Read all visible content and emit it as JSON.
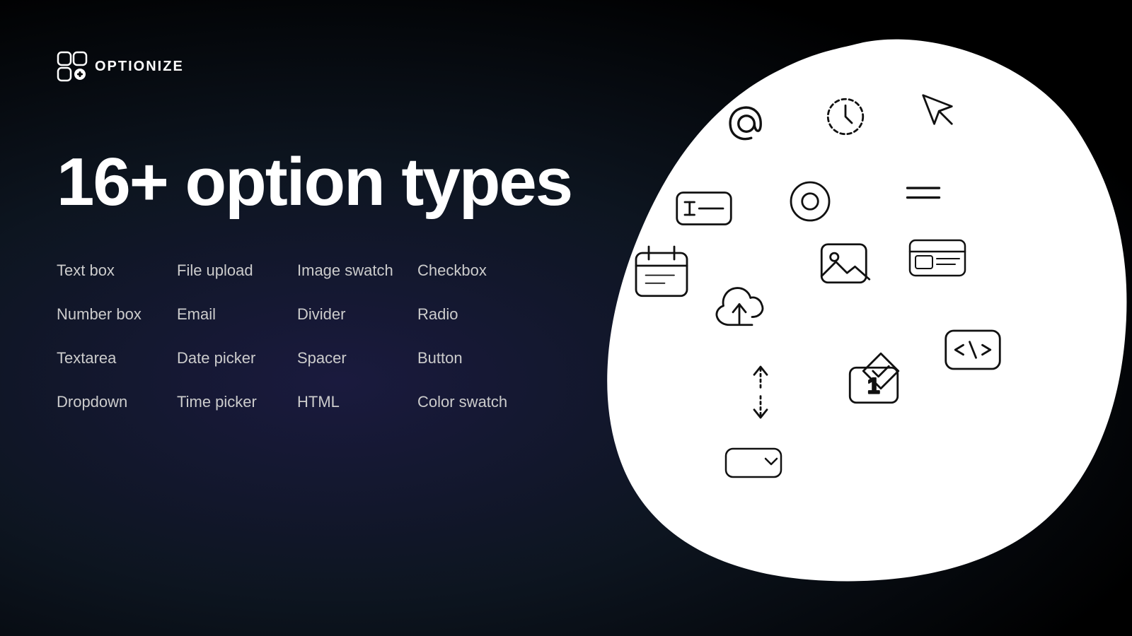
{
  "logo": {
    "text": "OPTIONIZE"
  },
  "heading": {
    "line1": "16+ option types"
  },
  "options": [
    {
      "label": "Text box"
    },
    {
      "label": "File upload"
    },
    {
      "label": "Image swatch"
    },
    {
      "label": "Checkbox"
    },
    {
      "label": "Number box"
    },
    {
      "label": "Email"
    },
    {
      "label": "Divider"
    },
    {
      "label": "Radio"
    },
    {
      "label": "Textarea"
    },
    {
      "label": "Date picker"
    },
    {
      "label": "Spacer"
    },
    {
      "label": "Button"
    },
    {
      "label": "Dropdown"
    },
    {
      "label": "Time picker"
    },
    {
      "label": "HTML"
    },
    {
      "label": "Color swatch"
    }
  ]
}
